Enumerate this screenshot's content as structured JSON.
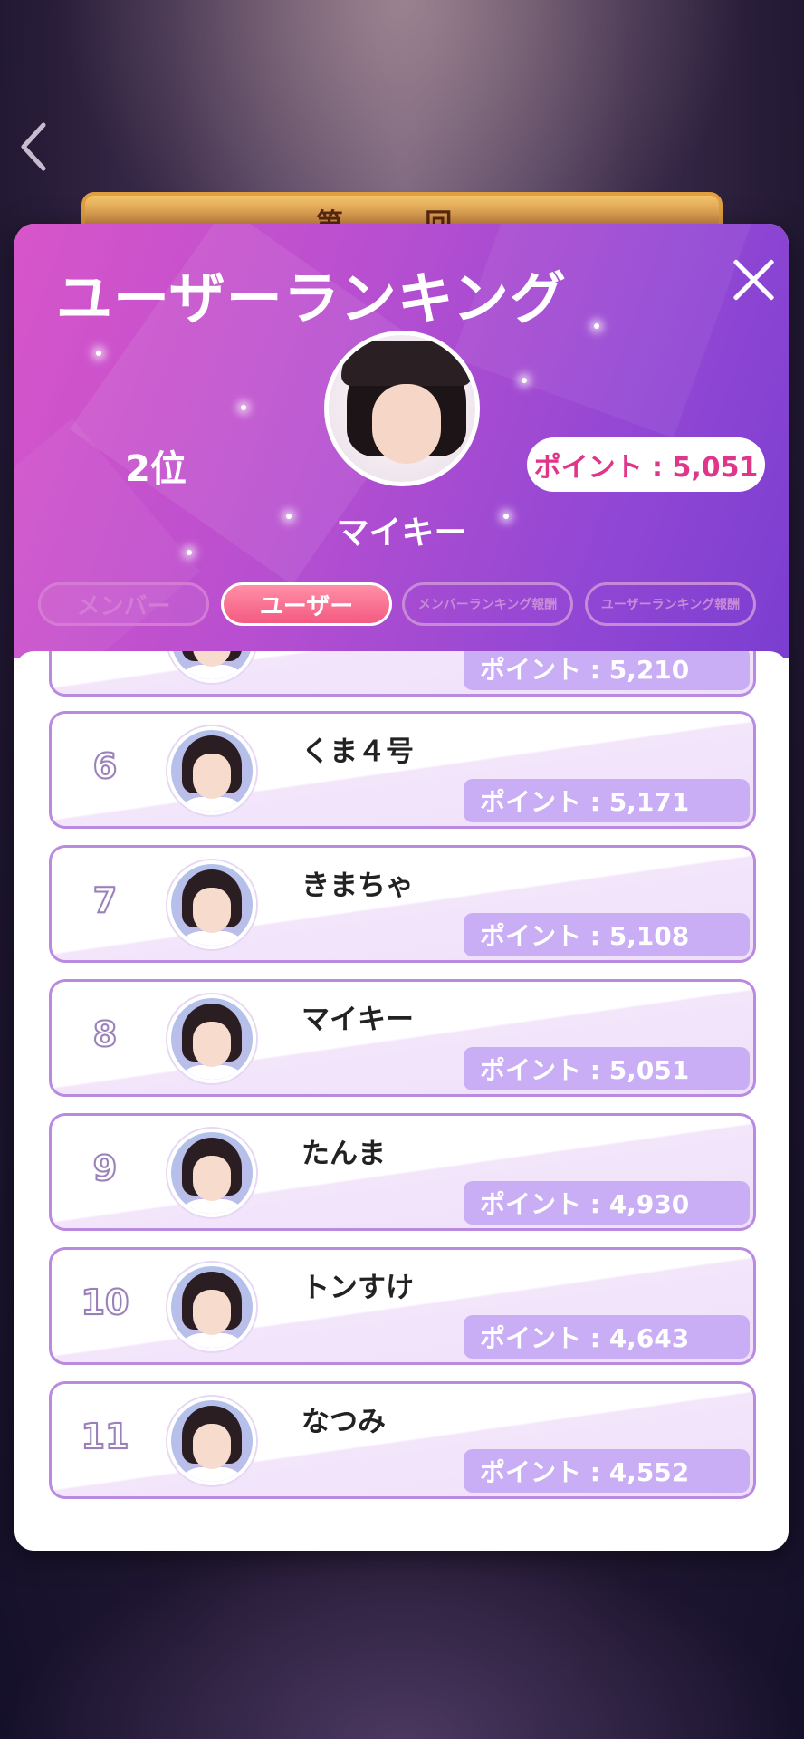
{
  "modal": {
    "title": "ユーザーランキング",
    "rank": "2位",
    "player_name": "マイキー",
    "player_points": "ポイント : 5,051"
  },
  "tabs": [
    {
      "label": "メンバー"
    },
    {
      "label": "ユーザー"
    },
    {
      "label": "メンバーランキング報酬"
    },
    {
      "label": "ユーザーランキング報酬"
    }
  ],
  "banner": {
    "text": "第 回"
  },
  "rows": [
    {
      "rank": "",
      "name": "",
      "points": "ポイント : 5,210"
    },
    {
      "rank": "6",
      "name": "くま４号",
      "points": "ポイント : 5,171"
    },
    {
      "rank": "7",
      "name": "きまちゃ",
      "points": "ポイント : 5,108"
    },
    {
      "rank": "8",
      "name": "マイキー",
      "points": "ポイント : 5,051"
    },
    {
      "rank": "9",
      "name": "たんま",
      "points": "ポイント : 4,930"
    },
    {
      "rank": "10",
      "name": "トンすけ",
      "points": "ポイント : 4,643"
    },
    {
      "rank": "11",
      "name": "なつみ",
      "points": "ポイント : 4,552"
    }
  ],
  "colors": {
    "header_gradient_start": "#d855c9",
    "header_gradient_end": "#7b3ed0",
    "points_pill_text": "#e0368a",
    "row_points_bg": "#c9aef5",
    "row_border": "#b98ae0",
    "active_tab": "#f45a82"
  }
}
